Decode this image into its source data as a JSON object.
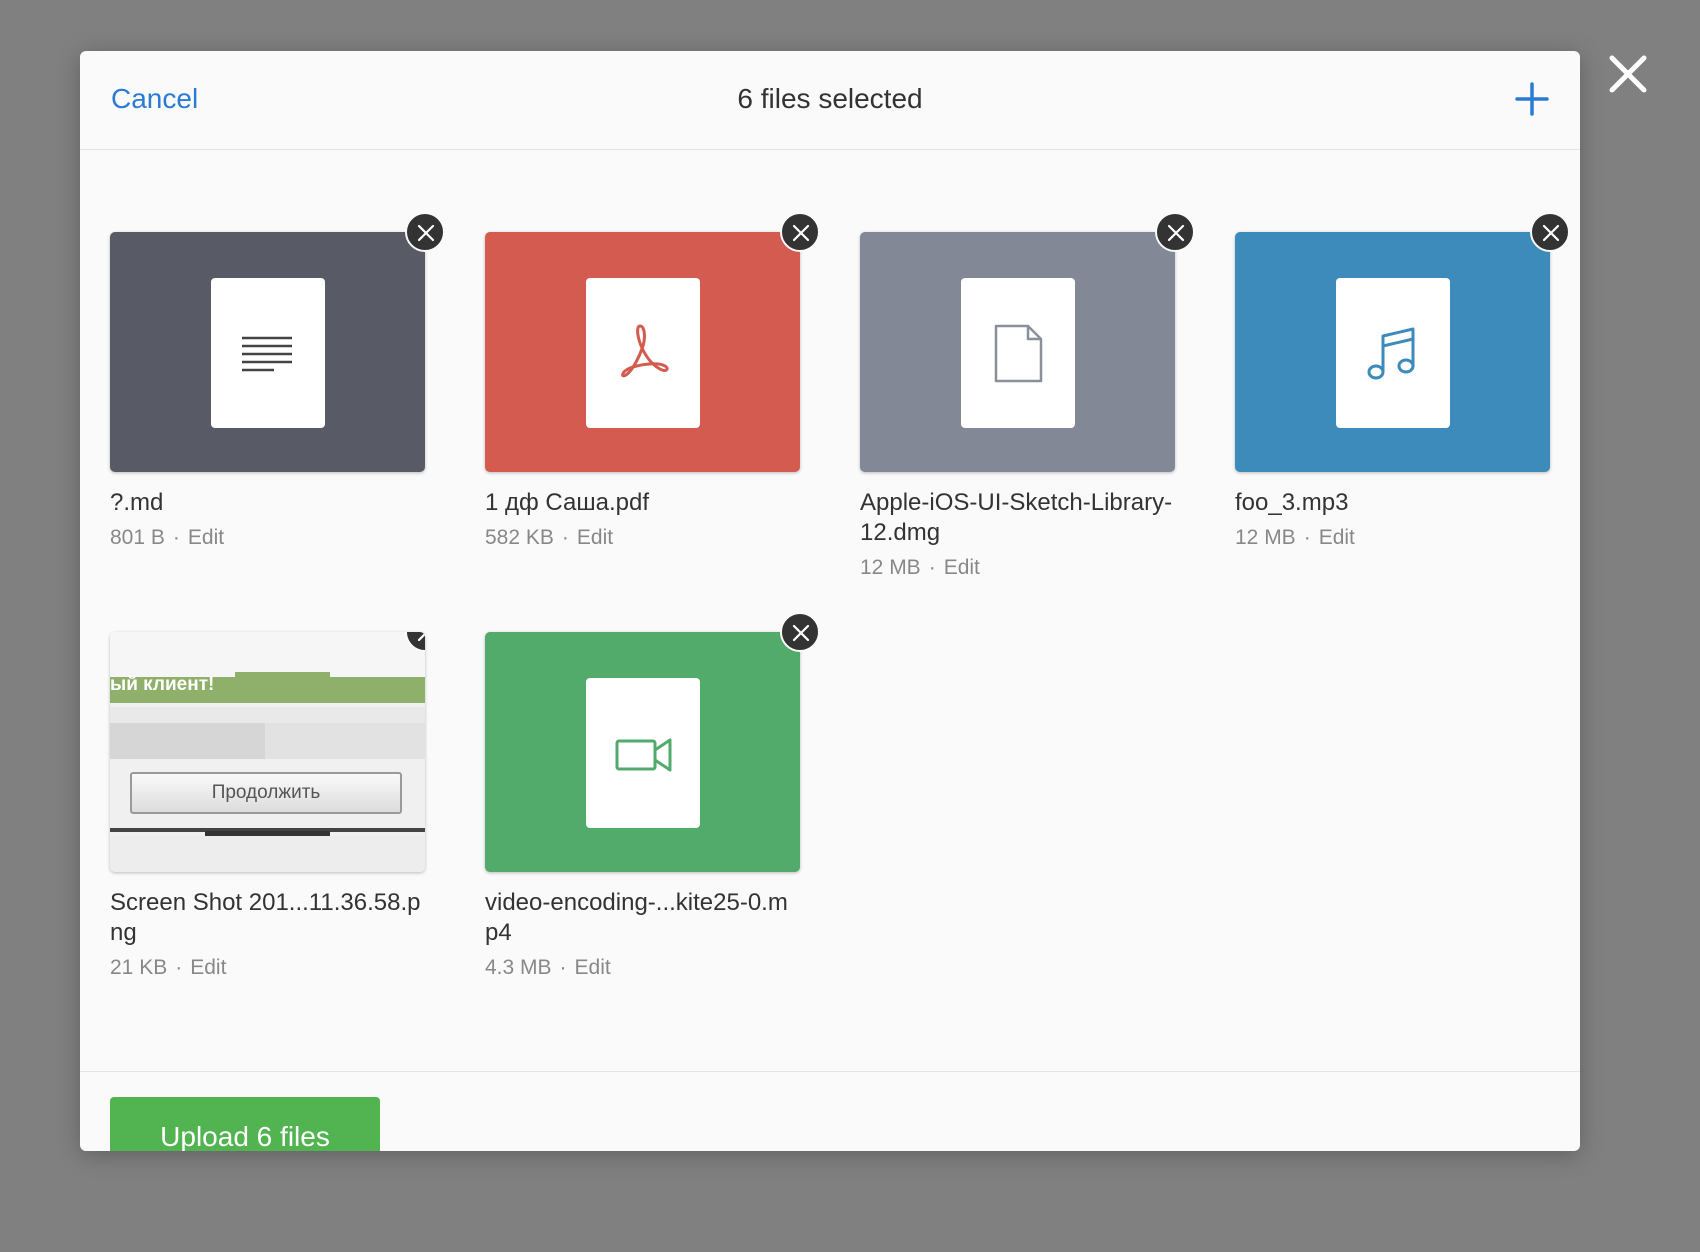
{
  "header": {
    "cancel_label": "Cancel",
    "title": "6 files selected"
  },
  "files": [
    {
      "name": "?.md",
      "size": "801 B",
      "edit_label": "Edit",
      "thumb_color": "#585b66",
      "icon": "text-lines-icon"
    },
    {
      "name": "1 дф Саша.pdf",
      "size": "582 KB",
      "edit_label": "Edit",
      "thumb_color": "#d35b4f",
      "icon": "pdf-icon"
    },
    {
      "name": "Apple-iOS-UI-Sketch-Library-12.dmg",
      "size": "12 MB",
      "edit_label": "Edit",
      "thumb_color": "#838896",
      "icon": "file-icon"
    },
    {
      "name": "foo_3.mp3",
      "size": "12 MB",
      "edit_label": "Edit",
      "thumb_color": "#3d8bbb",
      "icon": "music-note-icon"
    },
    {
      "name": "Screen Shot 201...11.36.58.png",
      "size": "21 KB",
      "edit_label": "Edit",
      "icon": "image-preview",
      "preview_text_1": "ый клиент!",
      "preview_text_2": "Продолжить"
    },
    {
      "name": "video-encoding-...kite25-0.mp4",
      "size": "4.3 MB",
      "edit_label": "Edit",
      "thumb_color": "#52ab6b",
      "icon": "video-camera-icon"
    }
  ],
  "meta_separator": "·",
  "footer": {
    "upload_label": "Upload 6 files"
  },
  "colors": {
    "accent_blue": "#2a7bd4",
    "upload_green": "#52b351",
    "remove_badge": "#333333"
  }
}
